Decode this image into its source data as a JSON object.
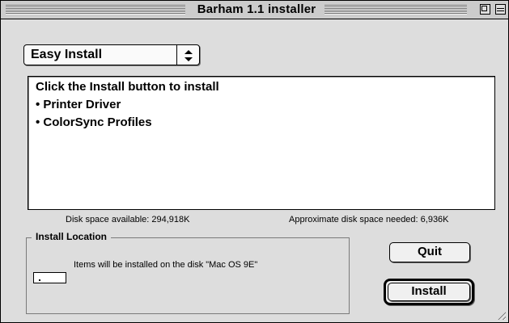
{
  "window": {
    "title": "Barham 1.1 installer"
  },
  "install_type": {
    "selected": "Easy Install",
    "arrow": "◆"
  },
  "details": {
    "header": "Click the Install button to install",
    "items": [
      "• Printer Driver",
      "• ColorSync Profiles"
    ]
  },
  "disk_space": {
    "available": "Disk space available: 294,918K",
    "needed": "Approximate disk space needed: 6,936K"
  },
  "location": {
    "title": "Install Location",
    "message": "Items will be installed on the disk \"Mac OS 9E\""
  },
  "buttons": {
    "quit": "Quit",
    "install": "Install"
  }
}
